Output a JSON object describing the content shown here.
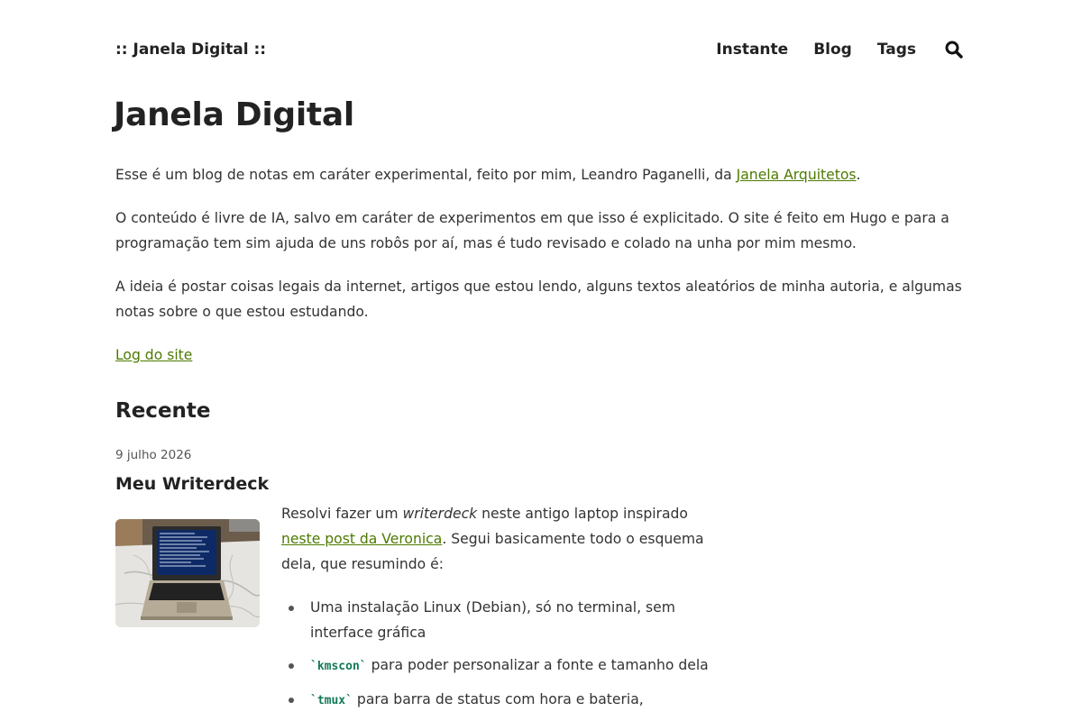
{
  "header": {
    "brand": ":: Janela Digital ::",
    "nav": [
      "Instante",
      "Blog",
      "Tags"
    ],
    "search_icon": "search-icon"
  },
  "page": {
    "title": "Janela Digital",
    "intro": {
      "p1_before": "Esse é um blog de notas em caráter experimental, feito por mim, Leandro Paganelli, da ",
      "p1_link": "Janela Arquitetos",
      "p1_after": ".",
      "p2": "O conteúdo é livre de IA, salvo em caráter de experimentos em que isso é explicitado. O site é feito em Hugo e para a programação tem sim ajuda de uns robôs por aí, mas é tudo revisado e colado na unha por mim mesmo.",
      "p3": "A ideia é postar coisas legais da internet, artigos que estou lendo, alguns textos aleatórios de minha autoria, e algumas notas sobre o que estou estudando."
    },
    "log_link": "Log do site"
  },
  "recent": {
    "heading": "Recente",
    "post": {
      "date": "9 julho 2026",
      "title": "Meu Writerdeck",
      "excerpt_1": "Resolvi fazer um ",
      "excerpt_em": "writerdeck",
      "excerpt_2": " neste antigo laptop inspirado ",
      "excerpt_link": "neste post da Veronica",
      "excerpt_3": ". Segui basicamente todo o esquema dela, que resumindo é:",
      "items": [
        {
          "code": "",
          "text": "Uma instalação Linux (Debian), só no terminal, sem interface gráfica"
        },
        {
          "code": "`kmscon`",
          "text": " para poder personalizar a fonte e tamanho dela"
        },
        {
          "code": "`tmux`",
          "text": " para barra de status com hora e bateria,"
        }
      ]
    }
  },
  "colors": {
    "link": "#4d7a00",
    "code": "#127a56",
    "text": "#333333"
  }
}
